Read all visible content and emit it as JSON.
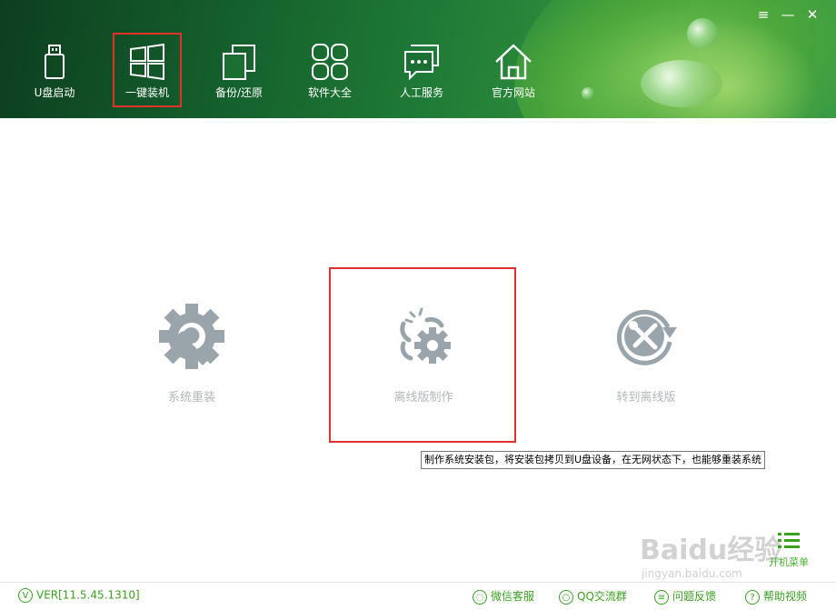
{
  "window_controls": {
    "menu": "≡",
    "minimize": "—",
    "close": "✕"
  },
  "nav": [
    {
      "label": "U盘启动",
      "icon": "usb-drive-icon"
    },
    {
      "label": "一键装机",
      "icon": "windows-logo-icon",
      "active": true
    },
    {
      "label": "备份/还原",
      "icon": "backup-restore-icon"
    },
    {
      "label": "软件大全",
      "icon": "apps-grid-icon"
    },
    {
      "label": "人工服务",
      "icon": "chat-bubble-icon"
    },
    {
      "label": "官方网站",
      "icon": "home-icon"
    }
  ],
  "cards": [
    {
      "label": "系统重装",
      "icon": "gear-wrench-icon"
    },
    {
      "label": "离线版制作",
      "icon": "broken-link-gear-icon"
    },
    {
      "label": "转到离线版",
      "icon": "tools-refresh-icon"
    }
  ],
  "tooltip": "制作系统安装包，将安装包拷贝到U盘设备，在无网状态下，也能够重装系统",
  "boot_menu": {
    "label": "开机菜单",
    "icon": "list-icon"
  },
  "footer": {
    "version": "VER[11.5.45.1310]",
    "links": [
      {
        "label": "微信客服",
        "icon": "wechat-icon"
      },
      {
        "label": "QQ交流群",
        "icon": "qq-icon"
      },
      {
        "label": "问题反馈",
        "icon": "feedback-icon"
      },
      {
        "label": "帮助视频",
        "icon": "help-icon"
      }
    ]
  },
  "watermark": {
    "main": "Baidu经验",
    "sub": "jingyan.baidu.com"
  },
  "colors": {
    "accent_green": "#3aa020",
    "highlight_red": "#e0322b",
    "icon_gray": "#9aa5ab"
  }
}
